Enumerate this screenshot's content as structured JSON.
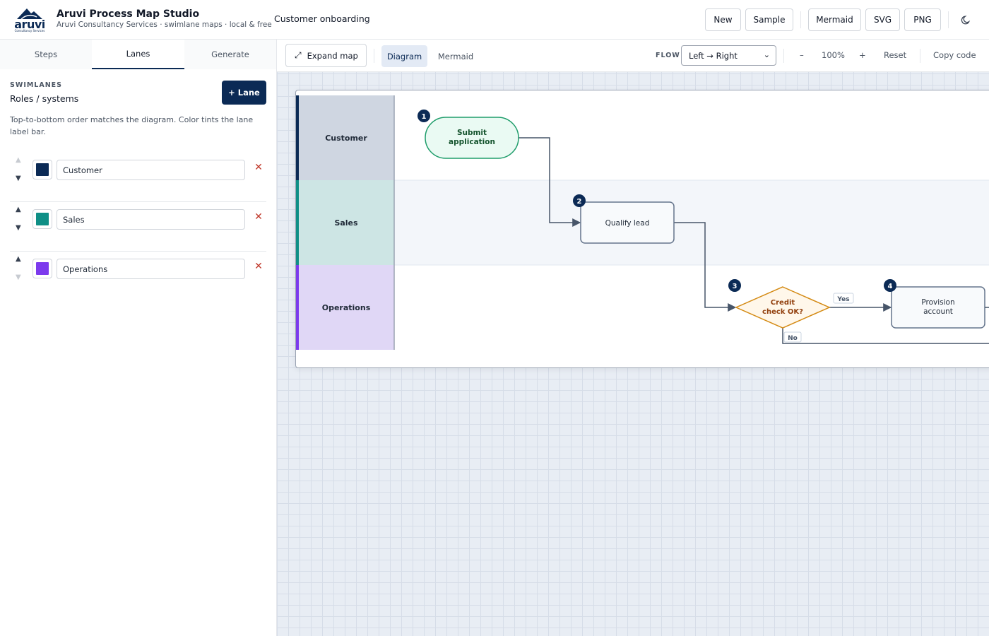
{
  "header": {
    "logo_text": "aruvi",
    "logo_subtext": "Consultancy Services",
    "app_title": "Aruvi Process Map Studio",
    "app_subtitle": "Aruvi Consultancy Services · swimlane maps · local & free",
    "document_title": "Customer onboarding",
    "buttons": {
      "new": "New",
      "sample": "Sample",
      "mermaid": "Mermaid",
      "svg": "SVG",
      "png": "PNG"
    },
    "theme_icon": "moon-icon"
  },
  "left_panel": {
    "tabs": [
      "Steps",
      "Lanes",
      "Generate"
    ],
    "active_tab": "Lanes",
    "section_label": "SWIMLANES",
    "section_title": "Roles / systems",
    "add_button": "+ Lane",
    "help_text": "Top-to-bottom order matches the diagram. Color tints the lane label bar.",
    "lanes": [
      {
        "name": "Customer",
        "color": "#0b2a55"
      },
      {
        "name": "Sales",
        "color": "#0f8f86"
      },
      {
        "name": "Operations",
        "color": "#7c3aed"
      }
    ]
  },
  "toolbar": {
    "expand_label": "Expand map",
    "views": [
      "Diagram",
      "Mermaid"
    ],
    "active_view": "Diagram",
    "flow_label": "FLOW",
    "flow_value": "Left → Right",
    "zoom_out": "–",
    "zoom_level": "100%",
    "zoom_in": "+",
    "reset": "Reset",
    "copy_code": "Copy code"
  },
  "diagram": {
    "lanes": [
      {
        "name": "Customer",
        "bar_color": "#0b2a55",
        "label_bg": "#cfd6e1"
      },
      {
        "name": "Sales",
        "bar_color": "#0f8f86",
        "label_bg": "#cde5e4"
      },
      {
        "name": "Operations",
        "bar_color": "#7c3aed",
        "label_bg": "#e0d7f6"
      }
    ],
    "steps": [
      {
        "number": "1",
        "label_lines": [
          "Submit",
          "application"
        ],
        "shape": "start"
      },
      {
        "number": "2",
        "label_lines": [
          "Qualify lead"
        ],
        "shape": "process"
      },
      {
        "number": "3",
        "label_lines": [
          "Credit",
          "check OK?"
        ],
        "shape": "decision"
      },
      {
        "number": "4",
        "label_lines": [
          "Provision",
          "account"
        ],
        "shape": "process"
      }
    ],
    "edge_labels": {
      "yes": "Yes",
      "no": "No"
    }
  }
}
